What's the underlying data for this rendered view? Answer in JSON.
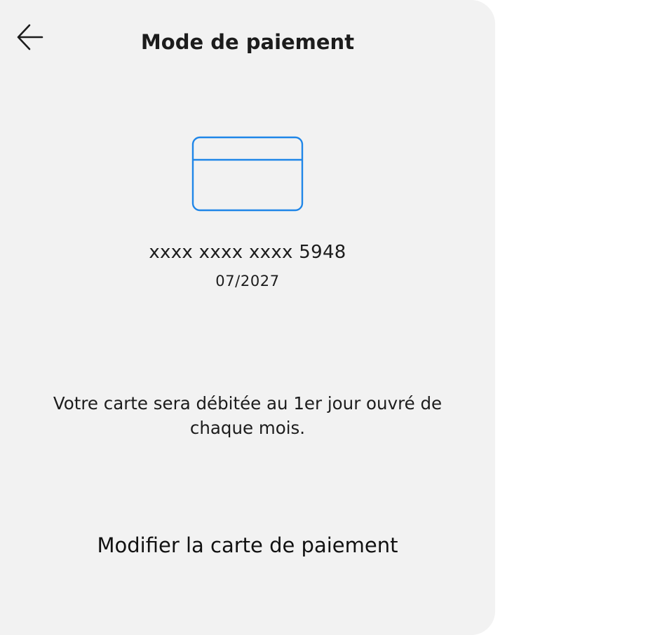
{
  "header": {
    "title": "Mode de paiement",
    "back_icon": "arrow-left-icon"
  },
  "card": {
    "icon": "credit-card-icon",
    "icon_color": "#1f86e8",
    "number": "xxxx xxxx xxxx 5948",
    "expiry": "07/2027"
  },
  "info": {
    "text": "Votre carte sera débitée au 1er jour ouvré de chaque mois."
  },
  "actions": {
    "modify_label": "Modifier la carte de paiement"
  },
  "colors": {
    "panel_background": "#f2f2f2",
    "text": "#1c1c1c",
    "accent": "#1f86e8"
  }
}
